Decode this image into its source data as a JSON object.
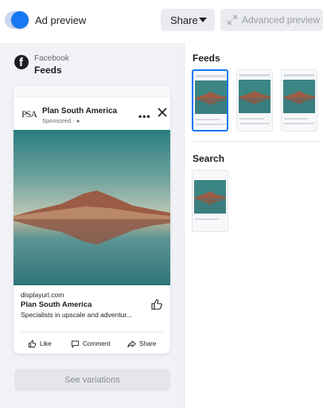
{
  "toolbar": {
    "toggle_label": "Ad preview",
    "toggle_on": true,
    "share_label": "Share",
    "advanced_label": "Advanced preview"
  },
  "preview": {
    "platform": "Facebook",
    "placement": "Feeds",
    "ad": {
      "brand_mark": "PSA",
      "advertiser": "Plan South America",
      "sponsored": "Sponsored · ",
      "display_url": "displayurl.com",
      "headline": "Plan South America",
      "description": "Specialists in upscale and adventur...",
      "actions": {
        "like": "Like",
        "comment": "Comment",
        "share": "Share"
      }
    },
    "see_variations": "See variations"
  },
  "placements": {
    "feeds_title": "Feeds",
    "search_title": "Search"
  },
  "colors": {
    "accent": "#1877f2",
    "panel_bg": "#f0f2f5",
    "sky_top": "#2f8486",
    "sky_bottom": "#b9c6b5",
    "mountain": "#9a5a44",
    "water": "#3b7d80"
  }
}
